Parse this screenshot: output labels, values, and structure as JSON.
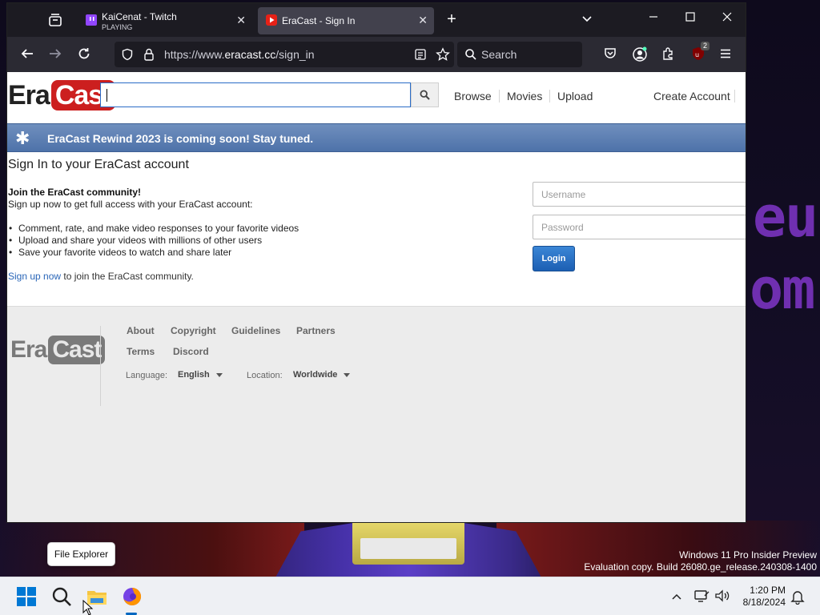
{
  "browser": {
    "tabs": [
      {
        "title": "KaiCenat - Twitch",
        "subtitle": "PLAYING",
        "favicon": "twitch-icon",
        "active": false
      },
      {
        "title": "EraCast - Sign In",
        "favicon": "eracast-icon",
        "active": true
      }
    ],
    "url": {
      "prefix": "https://www.",
      "domain": "eracast.cc",
      "path": "/sign_in"
    },
    "search_placeholder": "Search",
    "extension_badge": "2"
  },
  "site": {
    "logo": {
      "part1": "Era",
      "part2": "Cast"
    },
    "search_value": "",
    "nav": {
      "browse": "Browse",
      "movies": "Movies",
      "upload": "Upload",
      "create_account": "Create Account"
    },
    "banner": "EraCast Rewind 2023 is coming soon! Stay tuned.",
    "signin_title": "Sign In to your EraCast account",
    "join_heading": "Join the EraCast community!",
    "join_text": "Sign up now to get full access with your EraCast account:",
    "benefits": [
      "Comment, rate, and make video responses to your favorite videos",
      "Upload and share your videos with millions of other users",
      "Save your favorite videos to watch and share later"
    ],
    "signup_link": "Sign up now",
    "signup_suffix": " to join the EraCast community.",
    "login": {
      "username_placeholder": "Username",
      "password_placeholder": "Password",
      "button": "Login"
    },
    "footer": {
      "links": [
        "About",
        "Copyright",
        "Guidelines",
        "Partners",
        "Terms",
        "Discord"
      ],
      "language_label": "Language:",
      "language_value": "English",
      "location_label": "Location:",
      "location_value": "Worldwide"
    }
  },
  "desktop": {
    "watermark_line1": "Windows 11 Pro Insider Preview",
    "watermark_line2": "Evaluation copy. Build 26080.ge_release.240308-1400",
    "wallpaper_text_1": "eurl",
    "wallpaper_text_2": "om"
  },
  "taskbar": {
    "tooltip": "File Explorer",
    "time": "1:20 PM",
    "date": "8/18/2024"
  },
  "colors": {
    "brand_red": "#cc1f1f",
    "banner_blue": "#4e72a9",
    "login_blue": "#1c5fb3",
    "link_blue": "#2a66b8"
  }
}
